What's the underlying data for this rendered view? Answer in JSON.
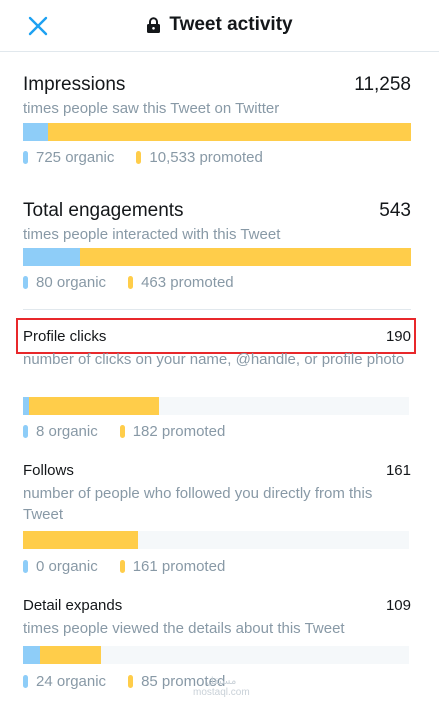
{
  "header": {
    "title": "Tweet activity",
    "close_icon": "close-icon",
    "lock_icon": "lock-icon"
  },
  "colors": {
    "organic": "#8ecdf8",
    "promoted": "#ffcd4a",
    "highlight": "#e8282b",
    "close": "#1da1f2"
  },
  "metrics": [
    {
      "title": "Impressions",
      "value": "11,258",
      "description": "times people saw this Tweet on Twitter",
      "organic_label": "725 organic",
      "promoted_label": "10,533 promoted",
      "organic": 725,
      "promoted": 10533
    },
    {
      "title": "Total engagements",
      "value": "543",
      "description": "times people interacted with this Tweet",
      "organic_label": "80 organic",
      "promoted_label": "463 promoted",
      "organic": 80,
      "promoted": 463
    },
    {
      "title": "Profile clicks",
      "value": "190",
      "description": "number of clicks on your name, @handle, or profile photo",
      "organic_label": "8 organic",
      "promoted_label": "182 promoted",
      "organic": 8,
      "promoted": 182
    },
    {
      "title": "Follows",
      "value": "161",
      "description": "number of people who followed you directly from this Tweet",
      "organic_label": "0 organic",
      "promoted_label": "161 promoted",
      "organic": 0,
      "promoted": 161
    },
    {
      "title": "Detail expands",
      "value": "109",
      "description": "times people viewed the details about this Tweet",
      "organic_label": "24 organic",
      "promoted_label": "85 promoted",
      "organic": 24,
      "promoted": 85
    }
  ],
  "watermark": {
    "line1": "مستقل",
    "line2": "mostaql.com"
  }
}
